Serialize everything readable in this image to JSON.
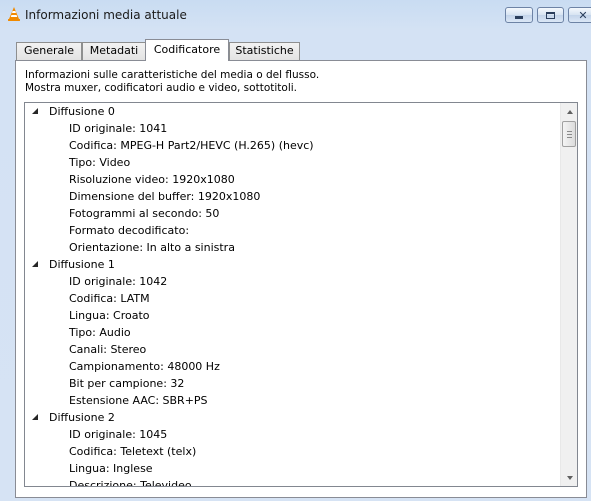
{
  "window": {
    "title": "Informazioni media attuale",
    "accent_color": "#d6e3f4"
  },
  "tabs": [
    {
      "label": "Generale",
      "active": false
    },
    {
      "label": "Metadati",
      "active": false
    },
    {
      "label": "Codificatore",
      "active": true
    },
    {
      "label": "Statistiche",
      "active": false
    }
  ],
  "codec_panel": {
    "description_line1": "Informazioni sulle caratteristiche del media o del flusso.",
    "description_line2": "Mostra muxer, codificatori audio e video, sottotitoli.",
    "streams": [
      {
        "title": "Diffusione 0",
        "expanded": true,
        "items": [
          "ID originale: 1041",
          "Codifica: MPEG-H Part2/HEVC (H.265) (hevc)",
          "Tipo: Video",
          "Risoluzione video: 1920x1080",
          "Dimensione del buffer: 1920x1080",
          "Fotogrammi al secondo: 50",
          "Formato decodificato:",
          "Orientazione: In alto a sinistra"
        ]
      },
      {
        "title": "Diffusione 1",
        "expanded": true,
        "items": [
          "ID originale: 1042",
          "Codifica: LATM",
          "Lingua: Croato",
          "Tipo: Audio",
          "Canali: Stereo",
          "Campionamento: 48000 Hz",
          "Bit per campione: 32",
          "Estensione AAC: SBR+PS"
        ]
      },
      {
        "title": "Diffusione 2",
        "expanded": true,
        "items": [
          "ID originale: 1045",
          "Codifica: Teletext (telx)",
          "Lingua: Inglese",
          "Descrizione: Televideo"
        ]
      }
    ]
  }
}
